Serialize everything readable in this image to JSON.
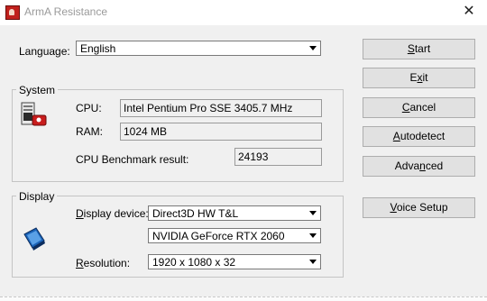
{
  "window": {
    "title": "ArmA Resistance",
    "close_glyph": "✕"
  },
  "language": {
    "label": "Language:",
    "value": "English"
  },
  "system": {
    "group_title": "System",
    "cpu_label": "CPU:",
    "cpu_value": "Intel Pentium Pro SSE 3405.7 MHz",
    "ram_label": "RAM:",
    "ram_value": "1024 MB",
    "bench_label": "CPU Benchmark result:",
    "bench_value": "24193"
  },
  "display": {
    "group_title": "Display",
    "device_label": "Display device:",
    "device_value": "Direct3D HW T&L",
    "adapter_value": "NVIDIA GeForce RTX 2060",
    "resolution_label": "Resolution:",
    "resolution_value": "1920 x 1080 x 32"
  },
  "buttons": {
    "start": "Start",
    "exit": "Exit",
    "cancel": "Cancel",
    "autodetect": "Autodetect",
    "advanced": "Advanced",
    "voice": "Voice Setup"
  },
  "icons": {
    "app": "arma-app-icon",
    "system": "computer-icon",
    "display": "display-icon"
  },
  "colors": {
    "title_text": "#9a9a9a",
    "button_face": "#e1e1e1",
    "dialog_bg": "#f0f0f0"
  }
}
